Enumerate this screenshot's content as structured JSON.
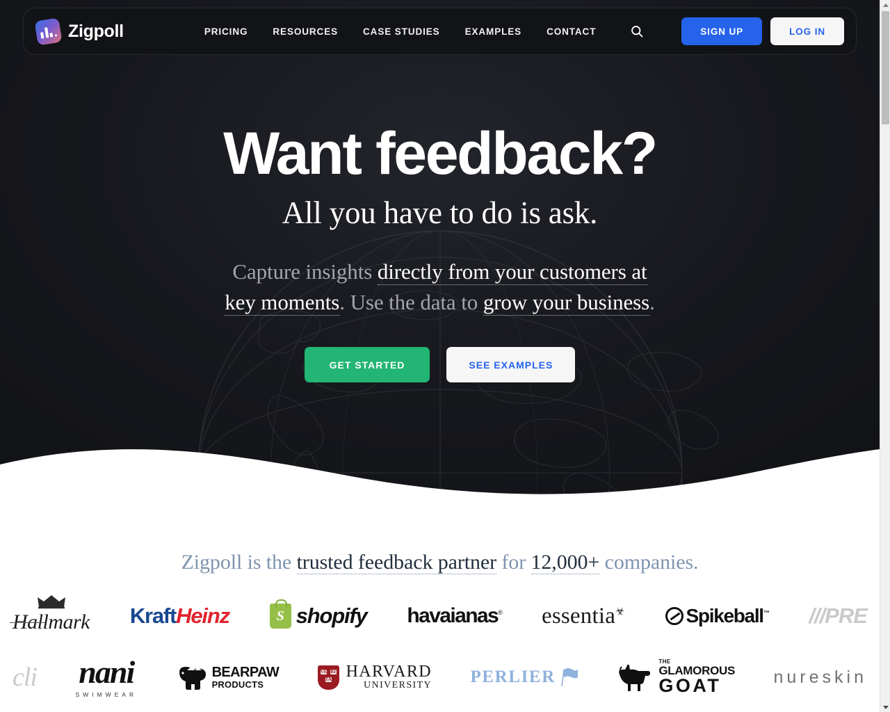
{
  "colors": {
    "hero_bg": "#15161a",
    "accent_blue": "#2563eb",
    "accent_green": "#22b573",
    "light_button": "#f6f6f7",
    "trust_text": "#7f94b0",
    "trust_text_strong": "#23303f"
  },
  "header": {
    "brand": "Zigpoll",
    "logo_icon": "bar-chart-logo-icon",
    "nav": [
      {
        "label": "PRICING"
      },
      {
        "label": "RESOURCES"
      },
      {
        "label": "CASE STUDIES"
      },
      {
        "label": "EXAMPLES"
      },
      {
        "label": "CONTACT"
      }
    ],
    "search_icon": "search-icon",
    "signup_label": "SIGN UP",
    "login_label": "LOG IN"
  },
  "hero": {
    "title": "Want feedback?",
    "subtitle": "All you have to do is ask.",
    "paragraph": {
      "p1": "Capture insights ",
      "h1": "directly from your customers at key moments",
      "p2": ". Use the data to ",
      "h2": "grow your business",
      "p3": "."
    },
    "cta_primary": "GET STARTED",
    "cta_secondary": "SEE EXAMPLES",
    "background_graphic": "globe-wireframe"
  },
  "trust": {
    "headline": {
      "p1": "Zigpoll is the ",
      "h1": "trusted feedback partner",
      "p2": " for ",
      "h2": "12,000+",
      "p3": " companies."
    },
    "row1": [
      {
        "name": "Hallmark",
        "text": "Hallmark"
      },
      {
        "name": "Kraft Heinz",
        "kraft": "Kraft",
        "heinz": "Heinz"
      },
      {
        "name": "Shopify",
        "mark": "S",
        "text": "shopify"
      },
      {
        "name": "havaianas",
        "text": "havaianas",
        "sup": "®"
      },
      {
        "name": "essentia",
        "text": "essentia"
      },
      {
        "name": "Spikeball",
        "text": "Spikeball",
        "sup": "™"
      },
      {
        "name": "PRE",
        "text": "///PRE"
      }
    ],
    "row2": [
      {
        "name": "cli",
        "text": "cli"
      },
      {
        "name": "nani swimwear",
        "text": "nani",
        "sub": "SWIMWEAR"
      },
      {
        "name": "Bearpaw Products",
        "t1": "BEARPAW",
        "t2": "PRODUCTS"
      },
      {
        "name": "Harvard University",
        "t1": "HARVARD",
        "t2": "UNIVERSITY",
        "shield": "VE RI TAS"
      },
      {
        "name": "Perlier",
        "text": "PERLIER"
      },
      {
        "name": "The Glamorous Goat",
        "t0": "THE",
        "t1": "GLAMOROUS",
        "t2": "GOAT"
      },
      {
        "name": "nureskin",
        "text": "nureskin",
        "fade": "n"
      }
    ]
  },
  "scrollbar": {
    "up_arrow": "scroll-up-arrow-icon",
    "down_arrow": "scroll-down-arrow-icon"
  }
}
